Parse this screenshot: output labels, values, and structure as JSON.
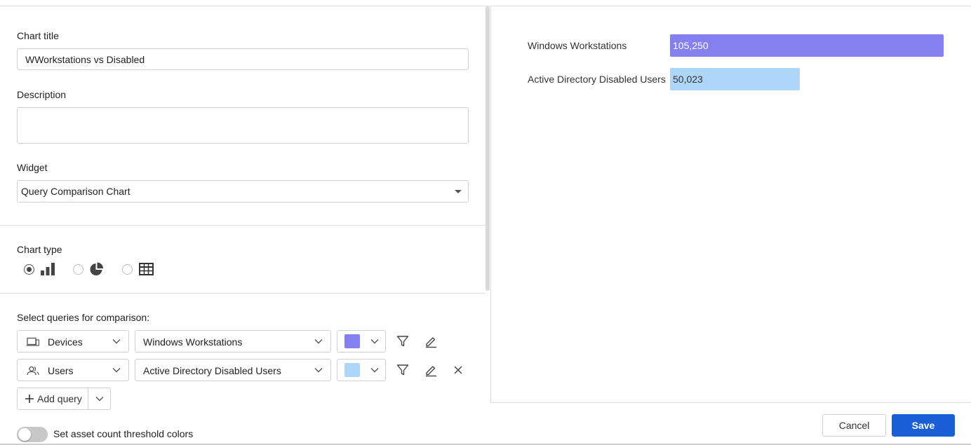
{
  "form": {
    "chart_title_label": "Chart title",
    "chart_title_value": "WWorkstations vs Disabled",
    "description_label": "Description",
    "description_value": "",
    "widget_label": "Widget",
    "widget_value": "Query Comparison Chart",
    "chart_type_label": "Chart type",
    "chart_types": [
      {
        "name": "bar",
        "icon": "bar-chart-icon",
        "selected": true
      },
      {
        "name": "pie",
        "icon": "pie-chart-icon",
        "selected": false
      },
      {
        "name": "table",
        "icon": "table-icon",
        "selected": false
      }
    ],
    "queries_label": "Select queries for comparison:",
    "queries": [
      {
        "entity": "Devices",
        "entity_icon": "devices-icon",
        "query": "Windows Workstations",
        "color": "#8480f0",
        "removable": false
      },
      {
        "entity": "Users",
        "entity_icon": "users-icon",
        "query": "Active Directory Disabled Users",
        "color": "#aed6fb",
        "removable": true
      }
    ],
    "add_query_label": "Add query",
    "threshold_toggle_label": "Set asset count threshold colors",
    "threshold_toggle_on": false
  },
  "preview": {
    "bars": [
      {
        "label": "Windows Workstations",
        "value": 105250,
        "display": "105,250",
        "color": "#8480f0",
        "text_color": "#ffffff"
      },
      {
        "label": "Active Directory Disabled Users",
        "value": 50023,
        "display": "50,023",
        "color": "#aed6fb",
        "text_color": "#333333"
      }
    ]
  },
  "footer": {
    "cancel_label": "Cancel",
    "save_label": "Save"
  }
}
